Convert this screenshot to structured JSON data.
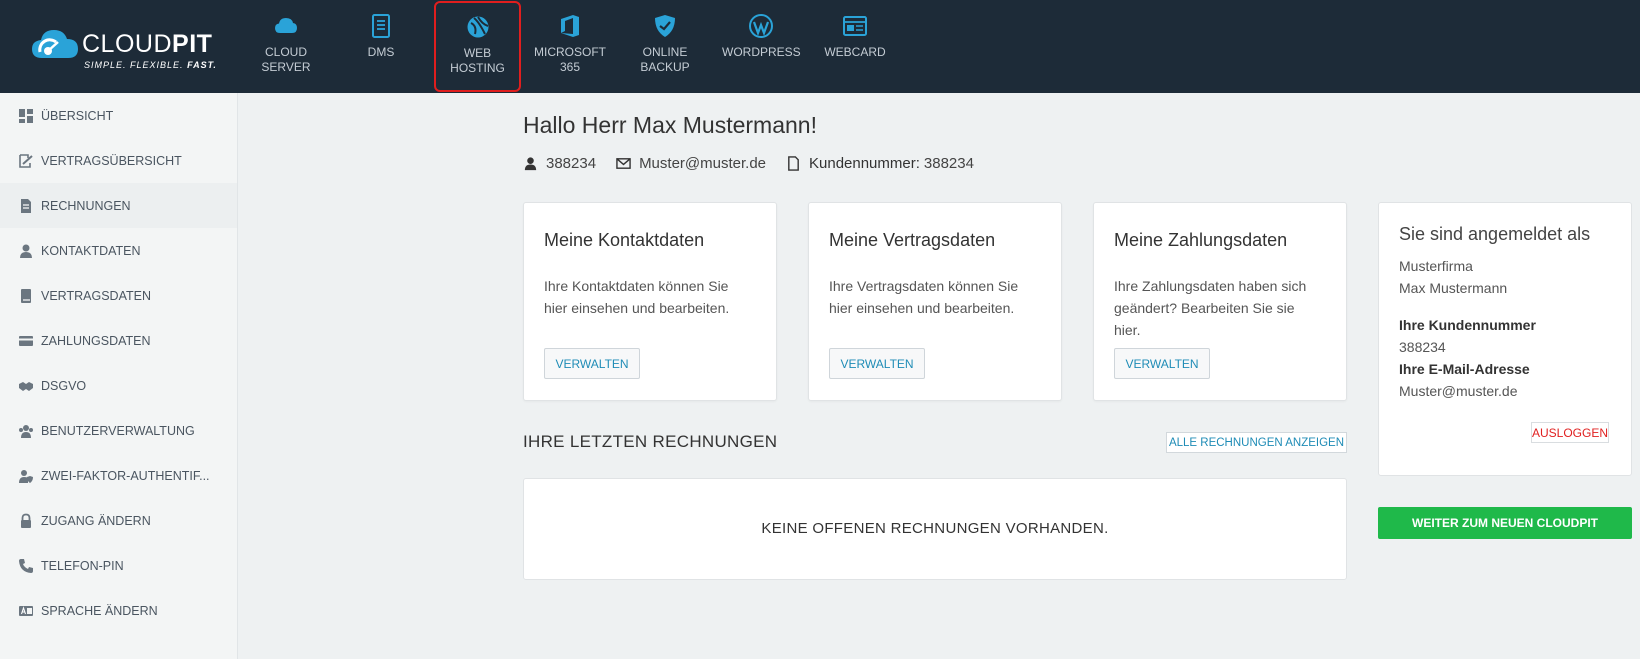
{
  "brand": {
    "name_light": "CLOUD",
    "name_bold": "PIT",
    "tagline_light": "SIMPLE. FLEXIBLE.",
    "tagline_bold": "FAST."
  },
  "topnav": [
    {
      "label_line1": "CLOUD",
      "label_line2": "SERVER",
      "icon": "cloud-icon"
    },
    {
      "label_line1": "DMS",
      "label_line2": "",
      "icon": "document-icon"
    },
    {
      "label_line1": "WEB",
      "label_line2": "HOSTING",
      "icon": "globe-icon",
      "active": true
    },
    {
      "label_line1": "MICROSOFT 365",
      "label_line2": "",
      "icon": "office-icon"
    },
    {
      "label_line1": "ONLINE",
      "label_line2": "BACKUP",
      "icon": "shield-icon"
    },
    {
      "label_line1": "WORDPRESS",
      "label_line2": "",
      "icon": "wordpress-icon"
    },
    {
      "label_line1": "WEBCARD",
      "label_line2": "",
      "icon": "webcard-icon"
    }
  ],
  "sidebar": [
    {
      "label": "ÜBERSICHT",
      "icon": "dashboard-icon"
    },
    {
      "label": "VERTRAGSÜBERSICHT",
      "icon": "signature-icon"
    },
    {
      "label": "RECHNUNGEN",
      "icon": "invoice-icon",
      "active": true
    },
    {
      "label": "KONTAKTDATEN",
      "icon": "user-icon"
    },
    {
      "label": "VERTRAGSDATEN",
      "icon": "book-icon"
    },
    {
      "label": "ZAHLUNGSDATEN",
      "icon": "credit-card-icon"
    },
    {
      "label": "DSGVO",
      "icon": "handshake-icon"
    },
    {
      "label": "BENUTZERVERWALTUNG",
      "icon": "users-icon"
    },
    {
      "label": "ZWEI-FAKTOR-AUTHENTIF...",
      "icon": "user-shield-icon"
    },
    {
      "label": "ZUGANG ÄNDERN",
      "icon": "lock-icon"
    },
    {
      "label": "TELEFON-PIN",
      "icon": "phone-icon"
    },
    {
      "label": "SPRACHE ÄNDERN",
      "icon": "language-icon"
    }
  ],
  "greeting": "Hallo Herr Max Mustermann!",
  "meta": {
    "user_id": "388234",
    "email": "Muster@muster.de",
    "customer_label": "Kundennummer:",
    "customer_number": "388234"
  },
  "cards": [
    {
      "title": "Meine Kontaktdaten",
      "desc": "Ihre Kontaktdaten können Sie hier einsehen und bearbeiten.",
      "button": "VERWALTEN"
    },
    {
      "title": "Meine Vertragsdaten",
      "desc": "Ihre Vertragsdaten können Sie hier einsehen und bearbeiten.",
      "button": "VERWALTEN"
    },
    {
      "title": "Meine Zahlungsdaten",
      "desc": "Ihre Zahlungsdaten haben sich geändert? Bearbeiten Sie sie hier.",
      "button": "VERWALTEN"
    }
  ],
  "invoices": {
    "title": "IHRE LETZTEN RECHNUNGEN",
    "show_all": "ALLE RECHNUNGEN ANZEIGEN",
    "empty": "KEINE OFFENEN RECHNUNGEN VORHANDEN."
  },
  "login": {
    "title": "Sie sind angemeldet als",
    "company": "Musterfirma",
    "name": "Max Mustermann",
    "customer_label": "Ihre Kundennummer",
    "customer_number": "388234",
    "email_label": "Ihre E-Mail-Adresse",
    "email": "Muster@muster.de",
    "logout": "AUSLOGGEN"
  },
  "cta": "WEITER ZUM NEUEN CLOUDPIT",
  "colors": {
    "topbar": "#1d2b38",
    "accent": "#1f8cb6",
    "active_border": "#e01e1e",
    "green": "#1fb94a",
    "logout": "#e02020"
  }
}
